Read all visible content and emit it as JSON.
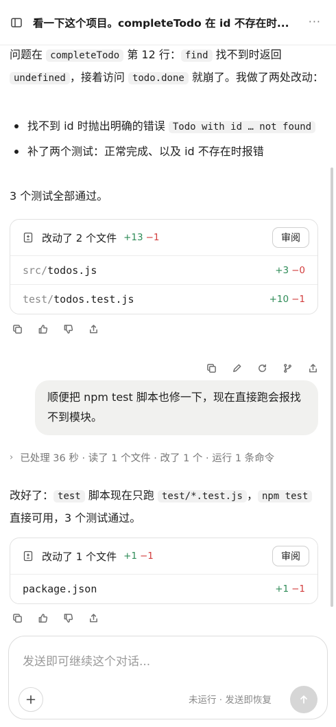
{
  "header": {
    "title": "看一下这个项目。completeTodo 在 id 不存在时...",
    "sidebar_icon": "sidebar-toggle-icon",
    "more_label": "···"
  },
  "msg1": {
    "p1_a": "问题在 ",
    "p1_code1": "completeTodo",
    "p1_b": " 第 12 行：",
    "p1_code2": "find",
    "p1_c": " 找不到时返回 ",
    "p1_code3": "undefined",
    "p1_d": "，接着访问 ",
    "p1_code4": "todo.done",
    "p1_e": " 就崩了。我做了两处改动：",
    "bullet1_a": "找不到 id 时抛出明确的错误 ",
    "bullet1_code": "Todo with id … not found",
    "bullet2": "补了两个测试：正常完成、以及 id 不存在时报错",
    "p2": "3 个测试全部通过。",
    "card": {
      "summary": "改动了 2 个文件",
      "added": "+13",
      "removed": "−1",
      "review_label": "审阅",
      "files": [
        {
          "dir": "src/",
          "name": "todos.js",
          "added": "+3",
          "removed": "−0"
        },
        {
          "dir": "test/",
          "name": "todos.test.js",
          "added": "+10",
          "removed": "−1"
        }
      ]
    }
  },
  "user_msg": {
    "text": "顺便把 npm test 脚本也修一下，现在直接跑会报找不到模块。"
  },
  "processed": {
    "text": "已处理 36 秒 · 读了 1 个文件 · 改了 1 个 · 运行 1 条命令"
  },
  "msg2": {
    "a": "改好了：",
    "code1": "test",
    "b": " 脚本现在只跑 ",
    "code2": "test/*.test.js",
    "c": "，",
    "code3": "npm test",
    "d": " 直接可用，3 个测试通过。",
    "card": {
      "summary": "改动了 1 个文件",
      "added": "+1",
      "removed": "−1",
      "review_label": "审阅",
      "files": [
        {
          "dir": "",
          "name": "package.json",
          "added": "+1",
          "removed": "−1"
        }
      ]
    }
  },
  "composer": {
    "placeholder": "发送即可继续这个对话...",
    "status": "未运行 · 发送即恢复"
  }
}
